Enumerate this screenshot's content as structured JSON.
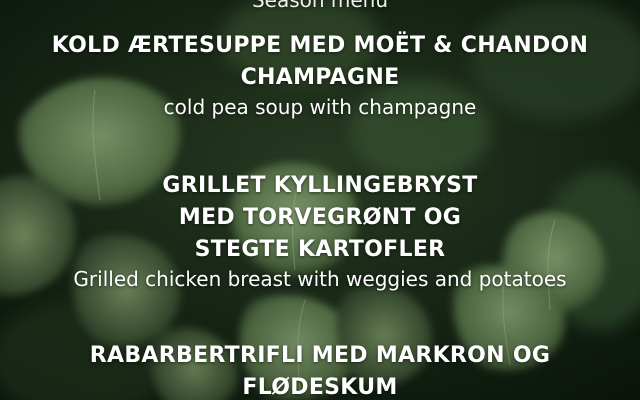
{
  "header": {
    "season_label": "Season menu"
  },
  "courses": [
    {
      "title_lines": [
        "KOLD ÆRTESUPPE MED MOËT & CHANDON",
        "CHAMPAGNE"
      ],
      "description": "cold pea soup with champagne"
    },
    {
      "title_lines": [
        "GRILLET KYLLINGEBRYST",
        "MED TORVEGRØNT OG",
        "STEGTE KARTOFLER"
      ],
      "description": "Grilled chicken breast with weggies and potatoes"
    },
    {
      "title_lines": [
        "RABARBERTRIFLI MED MARKRON OG",
        "FLØDESKUM"
      ]
    }
  ],
  "colors": {
    "text": "#ffffff",
    "leaf_light": "#9fb98a",
    "leaf_dark": "#3d5a33",
    "background": "#0e1a10"
  }
}
